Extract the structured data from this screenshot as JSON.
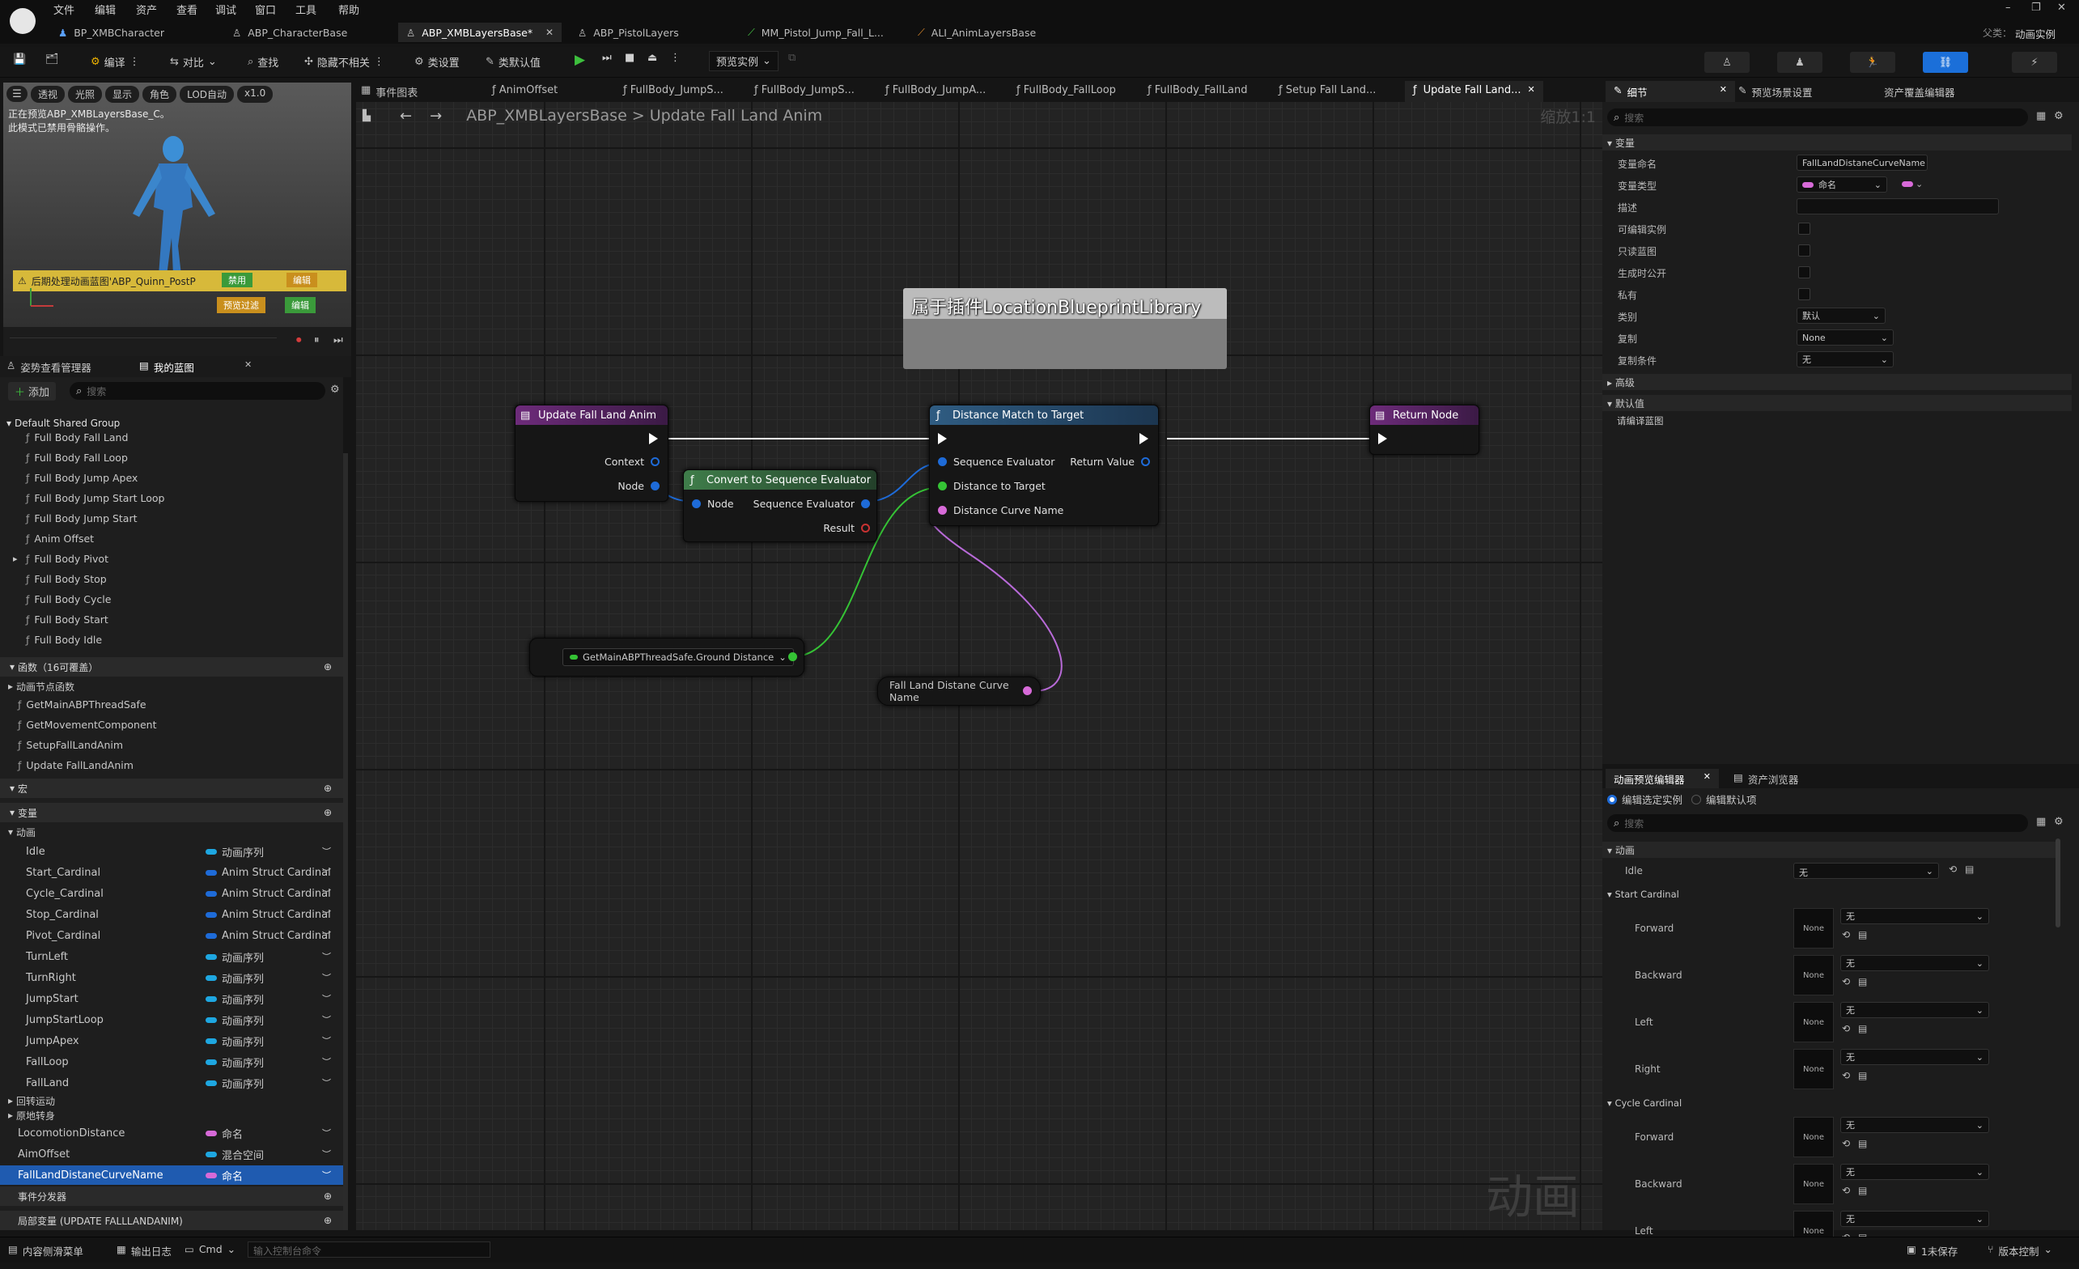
{
  "title_bar": {
    "menus": [
      "文件",
      "编辑",
      "资产",
      "查看",
      "调试",
      "窗口",
      "工具",
      "帮助"
    ],
    "tabs": [
      "BP_XMBCharacter",
      "ABP_CharacterBase",
      "ABP_XMBLayersBase*",
      "ABP_PistolLayers",
      "MM_Pistol_Jump_Fall_L...",
      "ALI_AnimLayersBase"
    ],
    "right_label": "父类：",
    "parent_class": "动画实例"
  },
  "toolbar": {
    "compile": "编译",
    "diff": "对比",
    "find": "查找",
    "hide_unrelated": "隐藏不相关",
    "class_settings": "类设置",
    "class_defaults": "类默认值",
    "preview_instance": "预览实例"
  },
  "viewport": {
    "buttons": [
      "透视",
      "光照",
      "显示",
      "角色",
      "LOD自动",
      "x1.0"
    ],
    "notice_line1": "正在预览ABP_XMBLayersBase_C。",
    "notice_line2": "此模式已禁用骨骼操作。",
    "warning_text": "后期处理动画蓝图'ABP_Quinn_PostP",
    "disable_button": "禁用",
    "edit_button": "编辑",
    "preview_filter_button": "预览过滤",
    "edit_button2": "编辑"
  },
  "left_tabs": [
    "姿势查看管理器",
    "我的蓝图"
  ],
  "my_blueprint": {
    "add_button": "添加",
    "search_placeholder": "搜索",
    "group_header": "Default Shared Group",
    "layers": [
      "Full Body Fall Land",
      "Full Body Fall Loop",
      "Full Body Jump Apex",
      "Full Body Jump Start Loop",
      "Full Body Jump Start",
      "Anim Offset",
      "Full Body Pivot",
      "Full Body Stop",
      "Full Body Cycle",
      "Full Body Start",
      "Full Body Idle"
    ],
    "functions_header": "函数（16可覆盖）",
    "anim_node_functions": "动画节点函数",
    "functions": [
      "GetMainABPThreadSafe",
      "GetMovementComponent",
      "SetupFallLandAnim",
      "Update FallLandAnim"
    ],
    "macros_header": "宏",
    "variables_header": "变量",
    "anim_category": "动画",
    "variables": [
      {
        "name": "Idle",
        "type": "动画序列",
        "color": "#1ea7e1"
      },
      {
        "name": "Start_Cardinal",
        "type": "Anim Struct Cardinal",
        "color": "#1e6bd8"
      },
      {
        "name": "Cycle_Cardinal",
        "type": "Anim Struct Cardinal",
        "color": "#1e6bd8"
      },
      {
        "name": "Stop_Cardinal",
        "type": "Anim Struct Cardinal",
        "color": "#1e6bd8"
      },
      {
        "name": "Pivot_Cardinal",
        "type": "Anim Struct Cardinal",
        "color": "#1e6bd8"
      },
      {
        "name": "TurnLeft",
        "type": "动画序列",
        "color": "#1ea7e1"
      },
      {
        "name": "TurnRight",
        "type": "动画序列",
        "color": "#1ea7e1"
      },
      {
        "name": "JumpStart",
        "type": "动画序列",
        "color": "#1ea7e1"
      },
      {
        "name": "JumpStartLoop",
        "type": "动画序列",
        "color": "#1ea7e1"
      },
      {
        "name": "JumpApex",
        "type": "动画序列",
        "color": "#1ea7e1"
      },
      {
        "name": "FallLoop",
        "type": "动画序列",
        "color": "#1ea7e1"
      },
      {
        "name": "FallLand",
        "type": "动画序列",
        "color": "#1ea7e1"
      }
    ],
    "category_turn": "回转运动",
    "category_turn_in_place": "原地转身",
    "variables2": [
      {
        "name": "LocomotionDistance",
        "type": "命名",
        "color": "#d76ad8"
      },
      {
        "name": "AimOffset",
        "type": "混合空间",
        "color": "#1ea7e1"
      },
      {
        "name": "FallLandDistaneCurveName",
        "type": "命名",
        "color": "#d76ad8"
      }
    ],
    "event_dispatchers": "事件分发器",
    "local_vars": "局部变量 (UPDATE FALLLANDANIM)"
  },
  "graph_tabs": [
    "事件图表",
    "AnimOffset",
    "FullBody_JumpS...",
    "FullBody_JumpS...",
    "FullBody_JumpA...",
    "FullBody_FallLoop",
    "FullBody_FallLand",
    "Setup Fall Land...",
    "Update Fall Land..."
  ],
  "breadcrumb": {
    "root": "ABP_XMBLayersBase",
    "separator": ">",
    "current": "Update Fall Land Anim",
    "zoom": "缩放1:1"
  },
  "graph": {
    "comment": "属于插件LocationBlueprintLibrary",
    "entry_node": {
      "title": "Update Fall Land Anim",
      "pins": [
        "Context",
        "Node"
      ]
    },
    "convert_node": {
      "title": "Convert to Sequence Evaluator",
      "input": "Node",
      "output": "Sequence Evaluator",
      "result": "Result"
    },
    "distance_node": {
      "title": "Distance Match to Target",
      "inputs": [
        "Sequence Evaluator",
        "Distance to Target",
        "Distance Curve Name"
      ],
      "output": "Return Value"
    },
    "return_node": {
      "title": "Return Node"
    },
    "getter_node": {
      "label": "GetMainABPThreadSafe.Ground Distance"
    },
    "var_node": {
      "label": "Fall Land Distane Curve Name"
    },
    "watermark": "动画"
  },
  "details": {
    "tabs": [
      "细节",
      "预览场景设置",
      "资产覆盖编辑器"
    ],
    "search_placeholder": "搜索",
    "variable_section": "变量",
    "rows": [
      {
        "label": "变量命名",
        "value": "FallLandDistaneCurveName"
      },
      {
        "label": "变量类型",
        "value": "命名"
      },
      {
        "label": "描述",
        "value": ""
      },
      {
        "label": "可编辑实例",
        "value": ""
      },
      {
        "label": "只读蓝图",
        "value": ""
      },
      {
        "label": "生成时公开",
        "value": ""
      },
      {
        "label": "私有",
        "value": ""
      },
      {
        "label": "类别",
        "value": "默认"
      },
      {
        "label": "复制",
        "value": "None"
      },
      {
        "label": "复制条件",
        "value": "无"
      }
    ],
    "advanced_section": "高级",
    "default_section": "默认值",
    "compile_hint": "请编译蓝图"
  },
  "anim_preview": {
    "tabs": [
      "动画预览编辑器",
      "资产浏览器"
    ],
    "radio_selected": "编辑选定实例",
    "radio_other": "编辑默认项",
    "search_placeholder": "搜索",
    "section": "动画",
    "idle_label": "Idle",
    "idle_value": "无",
    "start_cardinal": "Start Cardinal",
    "directions": [
      "Forward",
      "Backward",
      "Left",
      "Right"
    ],
    "cycle_cardinal": "Cycle Cardinal",
    "cycle_directions": [
      "Forward",
      "Backward",
      "Left"
    ],
    "none_thumb": "None",
    "none_value": "无"
  },
  "statusbar": {
    "content_drawer": "内容侧滑菜单",
    "output_log": "输出日志",
    "cmd": "Cmd",
    "console_placeholder": "输入控制台命令",
    "unsaved": "1未保存",
    "source_control": "版本控制"
  },
  "colors": {
    "exec": "#ffffff",
    "struct_pin": "#1e6bd8",
    "float_pin": "#35c335",
    "name_pin": "#d76ad8",
    "result_pin": "#c83232",
    "function_head": "#2a4f6b",
    "event_head": "#5a2566"
  }
}
